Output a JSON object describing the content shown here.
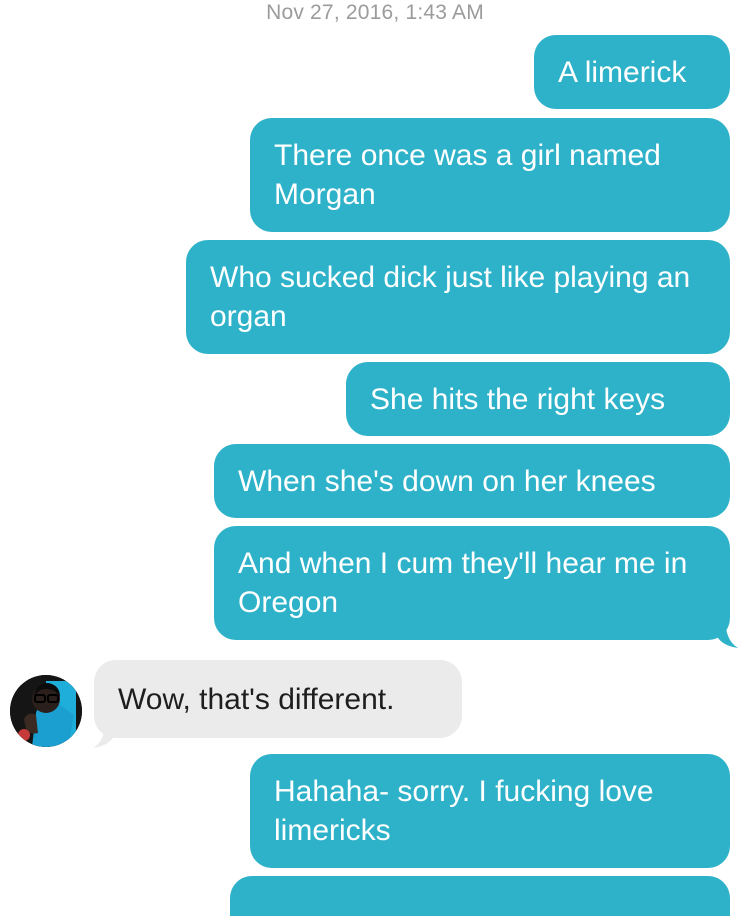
{
  "conversation": {
    "timestamp": "Nov 27, 2016, 1:43 AM",
    "messages": [
      {
        "id": "m1",
        "direction": "outgoing",
        "text": "A limerick"
      },
      {
        "id": "m2",
        "direction": "outgoing",
        "text": "There once was a girl named Morgan"
      },
      {
        "id": "m3",
        "direction": "outgoing",
        "text": "Who sucked dick just like playing an organ"
      },
      {
        "id": "m4",
        "direction": "outgoing",
        "text": "She hits the right keys"
      },
      {
        "id": "m5",
        "direction": "outgoing",
        "text": "When she's down on her knees"
      },
      {
        "id": "m6",
        "direction": "outgoing",
        "text": "And when I cum they'll hear me in Oregon"
      },
      {
        "id": "m7",
        "direction": "incoming",
        "text": "Wow, that's different."
      },
      {
        "id": "m8",
        "direction": "outgoing",
        "text": "Hahaha- sorry. I fucking love limericks"
      }
    ]
  },
  "colors": {
    "outgoing_bubble": "#2eb2c9",
    "incoming_bubble": "#ebebeb",
    "timestamp_text": "#9b9b9b"
  }
}
